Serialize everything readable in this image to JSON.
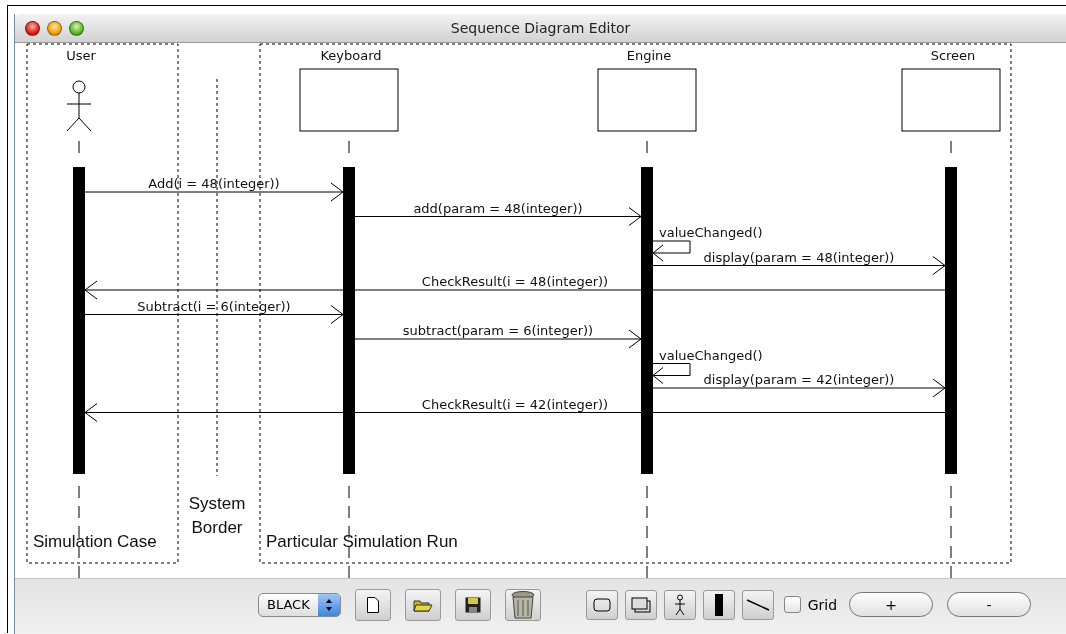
{
  "window": {
    "title": "Sequence Diagram Editor"
  },
  "frames": [
    {
      "label": "Simulation Case"
    },
    {
      "label": "Particular Simulation Run"
    }
  ],
  "system_border": {
    "lines": [
      "System",
      "Border"
    ]
  },
  "lifelines": [
    {
      "name": "User",
      "kind": "actor"
    },
    {
      "name": "Keyboard",
      "kind": "object"
    },
    {
      "name": "Engine",
      "kind": "object"
    },
    {
      "name": "Screen",
      "kind": "object"
    }
  ],
  "messages": [
    {
      "kind": "call",
      "label": "Add(i = 48(integer))"
    },
    {
      "kind": "call",
      "label": "add(param = 48(integer))"
    },
    {
      "kind": "self",
      "label": "valueChanged()"
    },
    {
      "kind": "call",
      "label": "display(param = 48(integer))"
    },
    {
      "kind": "call",
      "label": "CheckResult(i = 48(integer))"
    },
    {
      "kind": "call",
      "label": "Subtract(i = 6(integer))"
    },
    {
      "kind": "call",
      "label": "subtract(param = 6(integer))"
    },
    {
      "kind": "self",
      "label": "valueChanged()"
    },
    {
      "kind": "call",
      "label": "display(param = 42(integer))"
    },
    {
      "kind": "call",
      "label": "CheckResult(i = 42(integer))"
    }
  ],
  "toolbar": {
    "color_select": "BLACK",
    "grid": {
      "label": "Grid",
      "checked": false
    },
    "zoom_in": "+",
    "zoom_out": "-"
  }
}
